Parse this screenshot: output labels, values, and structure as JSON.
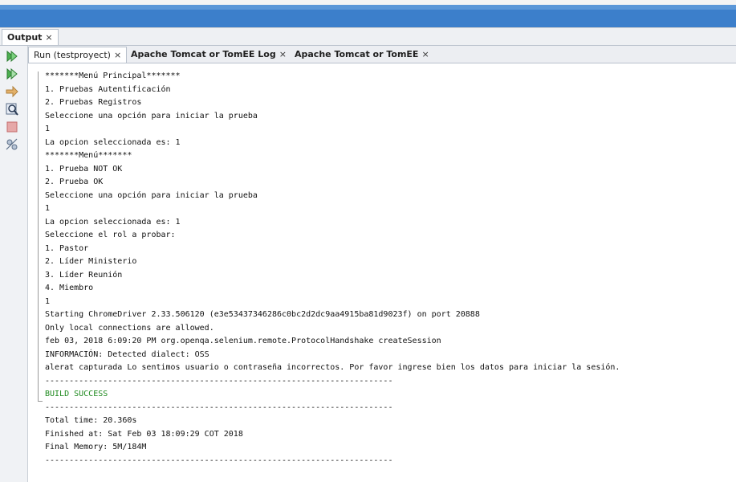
{
  "output_panel": {
    "title": "Output",
    "close": "×"
  },
  "subtabs": [
    {
      "label": "Run (testproyect)",
      "close": "×"
    },
    {
      "label": "Apache Tomcat or TomEE Log",
      "close": "×"
    },
    {
      "label": "Apache Tomcat or TomEE",
      "close": "×"
    }
  ],
  "toolbar_icons": [
    "rerun-icon",
    "rerun-with-args-icon",
    "stop-arrow-icon",
    "find-icon",
    "stop-icon",
    "settings-icon"
  ],
  "console_lines": [
    "*******Menú Principal*******",
    "1. Pruebas Autentificación",
    "2. Pruebas Registros",
    "Seleccione una opción para iniciar la prueba",
    "1",
    "La opcion seleccionada es: 1",
    "*******Menú*******",
    "1. Prueba NOT OK",
    "2. Prueba OK",
    "Seleccione una opción para iniciar la prueba",
    "1",
    "La opcion seleccionada es: 1",
    "Seleccione el rol a probar:",
    "1. Pastor",
    "2. Líder Ministerio",
    "3. Líder Reunión",
    "4. Miembro",
    "1",
    "Starting ChromeDriver 2.33.506120 (e3e53437346286c0bc2d2dc9aa4915ba81d9023f) on port 20888",
    "Only local connections are allowed.",
    "feb 03, 2018 6:09:20 PM org.openqa.selenium.remote.ProtocolHandshake createSession",
    "INFORMACIÓN: Detected dialect: OSS",
    "alerat capturada Lo sentimos usuario o contraseña incorrectos. Por favor ingrese bien los datos para iniciar la sesión.",
    "------------------------------------------------------------------------",
    "BUILD SUCCESS",
    "------------------------------------------------------------------------",
    "Total time: 20.360s",
    "Finished at: Sat Feb 03 18:09:29 COT 2018",
    "Final Memory: 5M/184M",
    "------------------------------------------------------------------------"
  ],
  "colors": {
    "titlebar": "#3c7fcb",
    "build_success": "#1f8a1f"
  }
}
